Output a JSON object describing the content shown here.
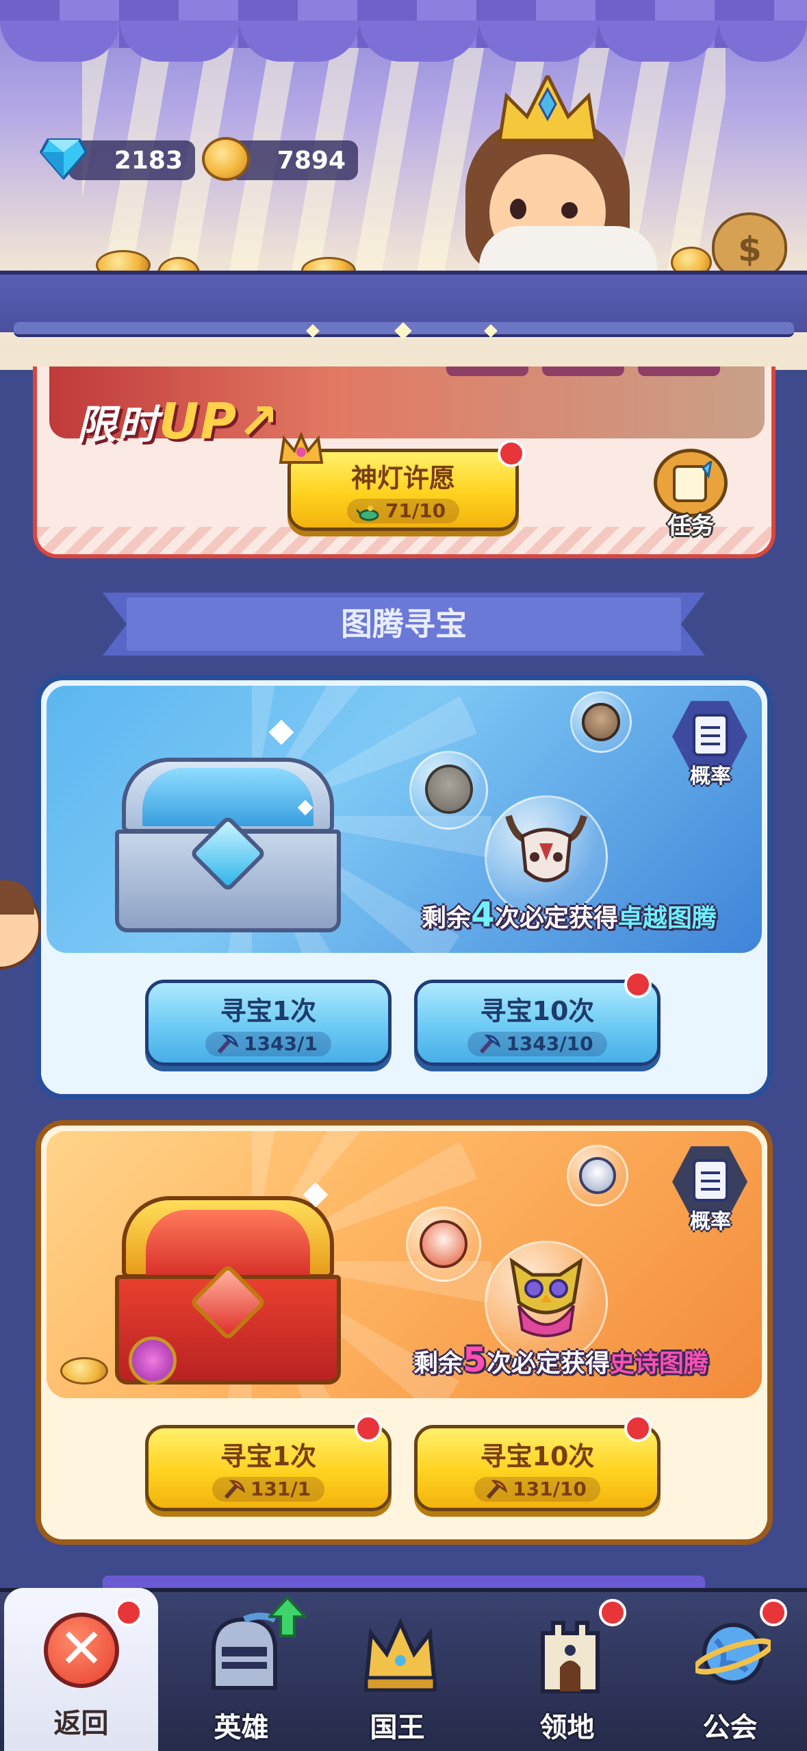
{
  "currencies": {
    "gems": "2183",
    "coins": "7894"
  },
  "lamp_panel": {
    "banner_text_a": "限时",
    "banner_text_b": "UP",
    "wish_button_label": "神灯许愿",
    "wish_cost": "71/10",
    "task_label": "任务"
  },
  "section_title": "图腾寻宝",
  "blue_treasure": {
    "guarantee_prefix": "剩余",
    "guarantee_count": "4",
    "guarantee_mid": "次必定获得",
    "guarantee_reward": "卓越图腾",
    "probability_label": "概率",
    "pull_once_label": "寻宝1次",
    "pull_once_cost": "1343/1",
    "pull_ten_label": "寻宝10次",
    "pull_ten_cost": "1343/10"
  },
  "orange_treasure": {
    "guarantee_prefix": "剩余",
    "guarantee_count": "5",
    "guarantee_mid": "次必定获得",
    "guarantee_reward": "史诗图腾",
    "probability_label": "概率",
    "pull_once_label": "寻宝1次",
    "pull_once_cost": "131/1",
    "pull_ten_label": "寻宝10次",
    "pull_ten_cost": "131/10"
  },
  "bottom_nav": {
    "items": [
      {
        "label": "返回",
        "icon": "close-icon"
      },
      {
        "label": "英雄",
        "icon": "helmet-icon"
      },
      {
        "label": "国王",
        "icon": "crown-icon"
      },
      {
        "label": "领地",
        "icon": "castle-icon"
      },
      {
        "label": "公会",
        "icon": "planet-icon"
      }
    ]
  },
  "colors": {
    "accent_red": "#e8353a",
    "epic_pink": "#ff4fb2",
    "excellent_blue": "#6ff0ff",
    "gold_button": "#ffd21f",
    "blue_button": "#6ccaf4"
  }
}
